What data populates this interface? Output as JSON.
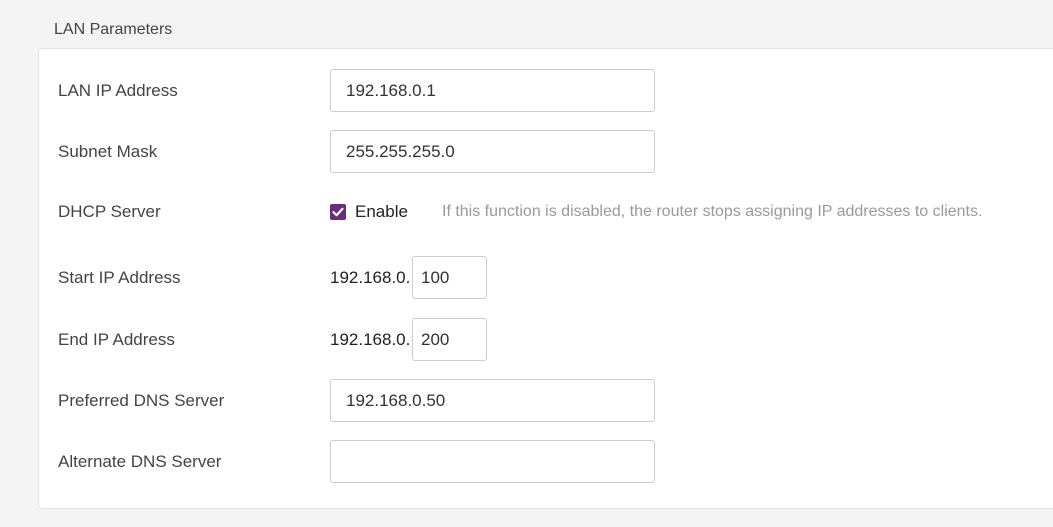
{
  "section": {
    "title": "LAN Parameters"
  },
  "fields": {
    "lan_ip": {
      "label": "LAN IP Address",
      "value": "192.168.0.1"
    },
    "subnet_mask": {
      "label": "Subnet Mask",
      "value": "255.255.255.0"
    },
    "dhcp": {
      "label": "DHCP Server",
      "checked": true,
      "checkbox_label": "Enable",
      "hint": "If this function is disabled, the router stops assigning IP addresses to clients."
    },
    "start_ip": {
      "label": "Start IP Address",
      "prefix": "192.168.0.",
      "value": "100"
    },
    "end_ip": {
      "label": "End IP Address",
      "prefix": "192.168.0.",
      "value": "200"
    },
    "preferred_dns": {
      "label": "Preferred DNS Server",
      "value": "192.168.0.50"
    },
    "alternate_dns": {
      "label": "Alternate DNS Server",
      "value": ""
    }
  },
  "colors": {
    "accent": "#6a2c7e",
    "background": "#f4f4f4",
    "panel": "#ffffff",
    "hint_text": "#9a9a9a"
  }
}
